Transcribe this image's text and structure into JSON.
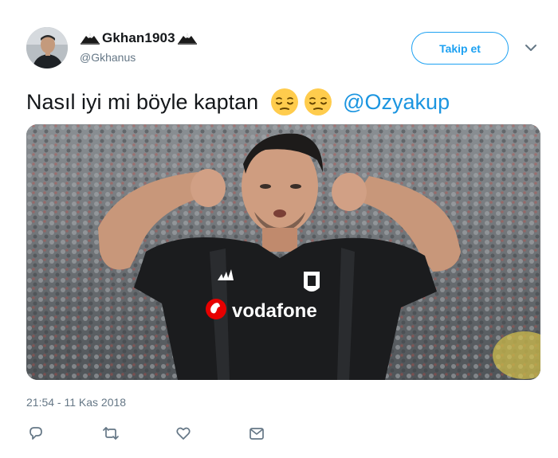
{
  "user": {
    "display_name": "Gkhan1903",
    "handle": "@Gkhanus",
    "name_decoration_icon": "eagle-icon"
  },
  "follow_button": {
    "label": "Takip et"
  },
  "menu": {
    "icon": "chevron-down-icon"
  },
  "tweet": {
    "text": "Nasıl iyi mi böyle kaptan",
    "emojis": [
      "pensive-face-emoji",
      "pensive-face-emoji"
    ],
    "mention": "@Ozyakup",
    "timestamp": "21:54 - 11 Kas 2018"
  },
  "media": {
    "shirt_sponsor_text": "vodafone",
    "description_icon": "photo-football-player"
  },
  "actions": [
    {
      "name": "reply",
      "icon": "reply-icon"
    },
    {
      "name": "retweet",
      "icon": "retweet-icon"
    },
    {
      "name": "like",
      "icon": "heart-icon"
    },
    {
      "name": "direct-message",
      "icon": "envelope-icon"
    }
  ],
  "colors": {
    "accent": "#1da1f2",
    "mention": "#1b95e0",
    "secondary_text": "#657786",
    "primary_text": "#14171a"
  }
}
